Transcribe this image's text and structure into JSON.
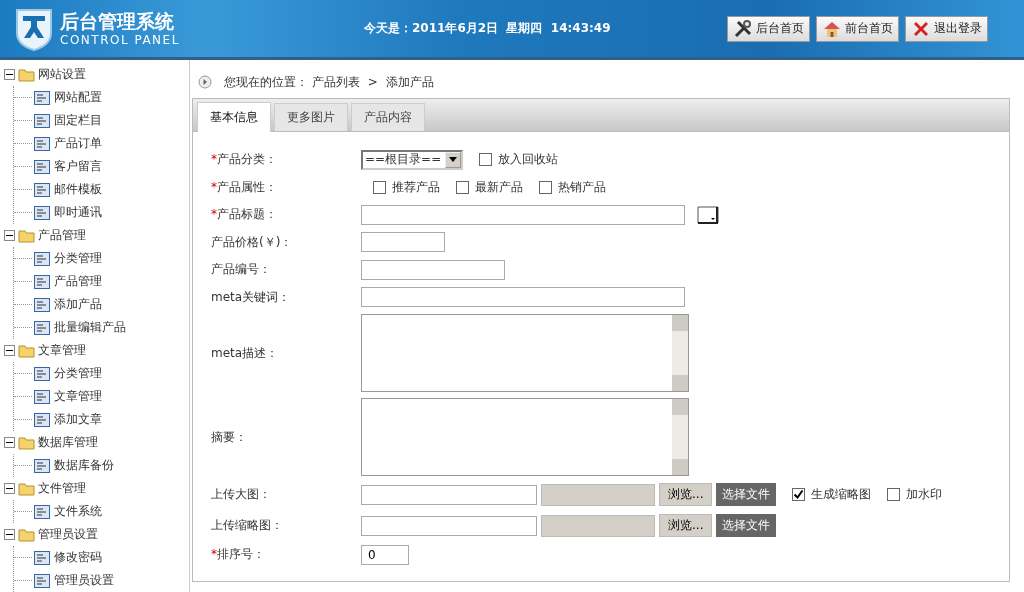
{
  "header": {
    "title": "后台管理系统",
    "subtitle": "CONTROL PANEL",
    "date": "今天是：2011年6月2日  星期四  14:43:49",
    "buttons": [
      {
        "kind": "tools",
        "label": "后台首页"
      },
      {
        "kind": "home",
        "label": "前台首页"
      },
      {
        "kind": "logout",
        "label": "退出登录"
      }
    ]
  },
  "sidebar": {
    "groups": [
      {
        "label": "网站设置",
        "expanded": true,
        "children": [
          "网站配置",
          "固定栏目",
          "产品订单",
          "客户留言",
          "邮件模板",
          "即时通讯"
        ]
      },
      {
        "label": "产品管理",
        "expanded": true,
        "children": [
          "分类管理",
          "产品管理",
          "添加产品",
          "批量编辑产品"
        ]
      },
      {
        "label": "文章管理",
        "expanded": true,
        "children": [
          "分类管理",
          "文章管理",
          "添加文章"
        ]
      },
      {
        "label": "数据库管理",
        "expanded": true,
        "children": [
          "数据库备份"
        ]
      },
      {
        "label": "文件管理",
        "expanded": true,
        "children": [
          "文件系统"
        ]
      },
      {
        "label": "管理员设置",
        "expanded": true,
        "children": [
          "修改密码",
          "管理员设置"
        ]
      }
    ]
  },
  "breadcrumb": {
    "label": "您现在的位置：",
    "path": "产品列表",
    "separator": " > ",
    "current": "添加产品"
  },
  "tabs": [
    {
      "label": "基本信息",
      "selected": true
    },
    {
      "label": "更多图片",
      "selected": false
    },
    {
      "label": "产品内容",
      "selected": false
    }
  ],
  "form": [
    {
      "kind": "select",
      "marker": "*",
      "label": "产品分类：",
      "value": "==根目录==",
      "checks": [
        {
          "label": "放入回收站",
          "checked": false
        }
      ]
    },
    {
      "kind": "checks",
      "marker": "*",
      "label": "产品属性：",
      "checks": [
        {
          "label": "推荐产品",
          "checked": false
        },
        {
          "label": "最新产品",
          "checked": false
        },
        {
          "label": "热销产品",
          "checked": false
        }
      ]
    },
    {
      "kind": "title",
      "marker": "*",
      "label": "产品标题："
    },
    {
      "kind": "short",
      "label": "产品价格(￥)："
    },
    {
      "kind": "medium",
      "label": "产品编号："
    },
    {
      "kind": "long",
      "label": "meta关键词："
    },
    {
      "kind": "textarea",
      "label": "meta描述："
    },
    {
      "kind": "textarea",
      "label": "摘要："
    },
    {
      "kind": "upload",
      "label": "上传大图：",
      "browse": "浏览...",
      "choose": "选择文件",
      "checks": [
        {
          "label": "生成缩略图",
          "checked": true
        },
        {
          "label": "加水印",
          "checked": false
        }
      ]
    },
    {
      "kind": "upload",
      "label": "上传缩略图：",
      "browse": "浏览...",
      "choose": "选择文件"
    },
    {
      "kind": "number",
      "marker": "*",
      "label": "排序号：",
      "value": "0"
    }
  ]
}
